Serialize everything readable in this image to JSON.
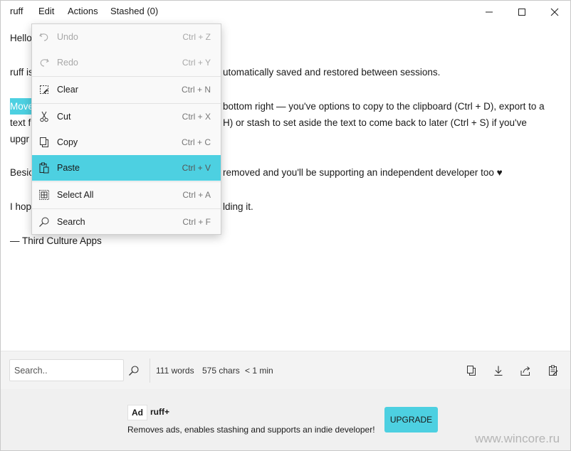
{
  "menubar": {
    "app": "ruff",
    "edit": "Edit",
    "actions": "Actions",
    "stashed": "Stashed (0)"
  },
  "editor": {
    "line1": "Hello",
    "line2_left": "ruff is",
    "line2_right": "utomatically saved and restored between sessions.",
    "line3_sel": "Move",
    "line3_right": "bottom right — you've options to copy to the clipboard (Ctrl + D), export to a",
    "line4_left": "text f",
    "line4_right": "H) or stash to set aside the text to come back to later (Ctrl + S) if you've",
    "line5_left": "upgr",
    "line6_left": "Besic",
    "line6_right": "removed and you'll be supporting an independent developer too ♥",
    "line7_left": "I hop",
    "line7_right": "lding it.",
    "line8": "— Third Culture Apps"
  },
  "edit_menu": {
    "items": [
      {
        "label": "Undo",
        "shortcut": "Ctrl + Z",
        "icon": "undo-icon"
      },
      {
        "label": "Redo",
        "shortcut": "Ctrl + Y",
        "icon": "redo-icon"
      },
      {
        "label": "Clear",
        "shortcut": "Ctrl + N",
        "icon": "clear-icon"
      },
      {
        "label": "Cut",
        "shortcut": "Ctrl + X",
        "icon": "cut-icon"
      },
      {
        "label": "Copy",
        "shortcut": "Ctrl + C",
        "icon": "copy-icon"
      },
      {
        "label": "Paste",
        "shortcut": "Ctrl + V",
        "icon": "paste-icon"
      },
      {
        "label": "Select All",
        "shortcut": "Ctrl + A",
        "icon": "select-all-icon"
      },
      {
        "label": "Search",
        "shortcut": "Ctrl + F",
        "icon": "search-icon"
      }
    ]
  },
  "toolbar": {
    "search_placeholder": "Search..",
    "words": "111 words",
    "chars": "575 chars",
    "time": "< 1 min"
  },
  "ad": {
    "tag": "Ad",
    "title": "ruff+",
    "description": "Removes ads, enables stashing and supports an indie developer!",
    "button": "UPGRADE"
  },
  "watermark": "www.wincore.ru",
  "colors": {
    "accent": "#4dd0e1",
    "menu_bg": "#f9f9f9",
    "toolbar_bg": "#f3f3f3"
  }
}
